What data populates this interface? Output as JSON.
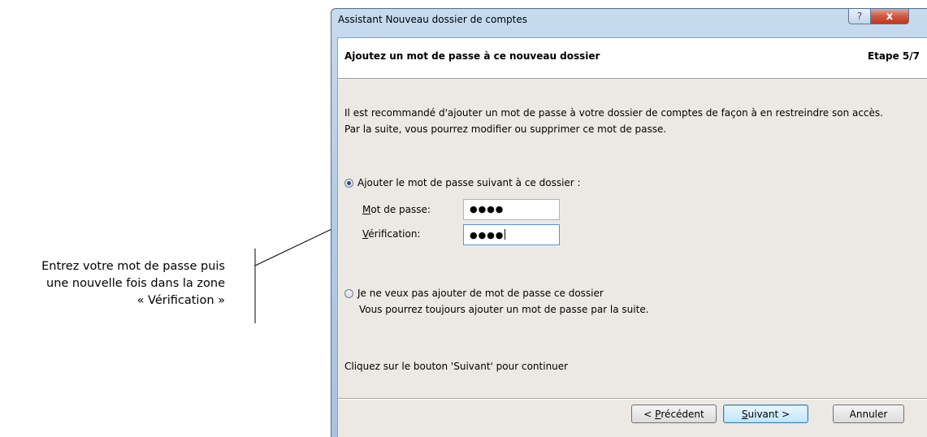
{
  "callout": {
    "line1": "Entrez votre mot de passe puis",
    "line2": "une nouvelle fois dans la zone",
    "line3": "« Vérification »"
  },
  "window": {
    "title": "Assistant Nouveau dossier de comptes",
    "help_glyph": "?",
    "close_glyph": "x"
  },
  "header": {
    "title": "Ajoutez un mot de passe à ce nouveau dossier",
    "step": "Etape 5/7"
  },
  "intro": {
    "line1": "Il est recommandé d'ajouter un mot de passe à votre dossier de comptes de façon à en restreindre son accès.",
    "line2": "Par la suite, vous pourrez  modifier ou supprimer ce mot de passe."
  },
  "option_add": {
    "label": "Ajouter le mot de passe suivant à ce dossier :",
    "selected": true,
    "password": {
      "label_mnemonic": "M",
      "label_rest": "ot de passe:",
      "value": "●●●●"
    },
    "verification": {
      "label_mnemonic": "V",
      "label_rest": "érification:",
      "value": "●●●●"
    }
  },
  "option_none": {
    "label": "Je ne veux pas ajouter de mot de passe ce dossier",
    "sublabel": "Vous pourrez toujours ajouter un mot de passe par la suite.",
    "selected": false
  },
  "footer_hint": "Cliquez sur le bouton 'Suivant' pour continuer",
  "buttons": {
    "prev_prefix": "< ",
    "prev_mnemonic": "P",
    "prev_rest": "récédent",
    "next_mnemonic": "S",
    "next_rest": "uivant >",
    "cancel": "Annuler"
  },
  "colors": {
    "accent": "#1f4f9a",
    "close": "#c0351c",
    "focus_border": "#5f93c9"
  }
}
